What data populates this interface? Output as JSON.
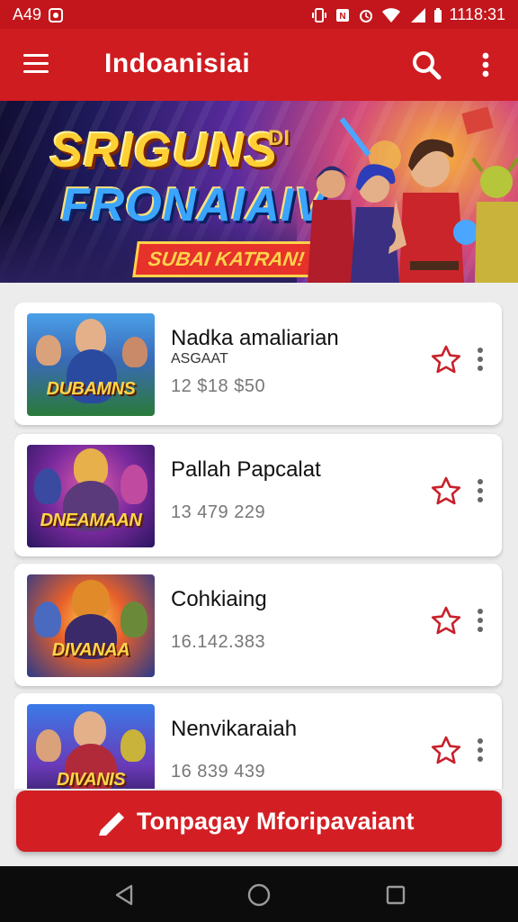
{
  "status_bar": {
    "left_text": "A49",
    "time": "1118:31",
    "icons": [
      "notification-icon",
      "vibrate-icon",
      "nfc-icon",
      "alarm-icon",
      "wifi-icon",
      "signal-icon",
      "battery-icon"
    ]
  },
  "app_bar": {
    "title": "Indoanisiai",
    "icons": [
      "menu-icon",
      "search-icon",
      "more-vert-icon"
    ]
  },
  "banner": {
    "line1": "SRIGUNS",
    "line1_badge": "DI",
    "line2": "FRONAIAIV",
    "tagline": "SUBAI KATRAN!"
  },
  "games": [
    {
      "title": "Nadka amaliarian",
      "subtitle": "ASGAAT",
      "stats": "12 $18 $50",
      "thumb_logo": "DUBAMNS",
      "favorite": false
    },
    {
      "title": "Pallah Papcalat",
      "subtitle": "",
      "stats": "13 479 229",
      "thumb_logo": "DNEAMAAN",
      "favorite": false
    },
    {
      "title": "Cohkiaing",
      "subtitle": "",
      "stats": "16.142.383",
      "thumb_logo": "DIVANAA",
      "favorite": false
    },
    {
      "title": "Nenvikaraiah",
      "subtitle": "",
      "stats": "16 839 439",
      "thumb_logo": "DIVANIS",
      "favorite": false
    }
  ],
  "action_button": {
    "label": "Tonpagay Mforipavaiant",
    "icon": "pencil-icon"
  },
  "nav_bar": {
    "icons": [
      "back-icon",
      "home-icon",
      "recents-icon"
    ]
  },
  "colors": {
    "primary": "#cf1c21",
    "status_bar": "#c2161c",
    "background": "#ececec",
    "star": "#c8212a"
  }
}
